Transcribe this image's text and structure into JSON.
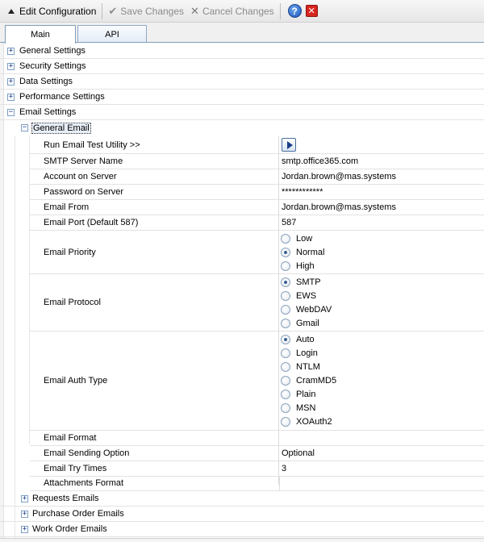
{
  "toolbar": {
    "edit_label": "Edit Configuration",
    "save_label": "Save Changes",
    "cancel_label": "Cancel Changes",
    "help_glyph": "?",
    "close_glyph": "✕",
    "check_glyph": "✔",
    "x_glyph": "✕"
  },
  "tabs": [
    {
      "label": "Main",
      "active": true
    },
    {
      "label": "API",
      "active": false
    }
  ],
  "tree": {
    "expand_glyph": "+",
    "collapse_glyph": "−",
    "sections": [
      {
        "label": "General Settings",
        "expanded": false
      },
      {
        "label": "Security Settings",
        "expanded": false
      },
      {
        "label": "Data Settings",
        "expanded": false
      },
      {
        "label": "Performance Settings",
        "expanded": false
      },
      {
        "label": "Email Settings",
        "expanded": true
      }
    ],
    "general_email": {
      "label": "General Email",
      "expanded": true
    },
    "subsections": [
      {
        "label": "Requests Emails"
      },
      {
        "label": "Purchase Order Emails"
      },
      {
        "label": "Work Order Emails"
      }
    ]
  },
  "props": {
    "run_test": {
      "label": "Run Email Test Utility >>"
    },
    "smtp_server": {
      "label": "SMTP Server Name",
      "value": "smtp.office365.com"
    },
    "account": {
      "label": "Account on Server",
      "value": "Jordan.brown@mas.systems"
    },
    "password": {
      "label": "Password on Server",
      "value": "************"
    },
    "email_from": {
      "label": "Email From",
      "value": "Jordan.brown@mas.systems"
    },
    "email_port": {
      "label": "Email Port (Default 587)",
      "value": "587"
    },
    "priority": {
      "label": "Email Priority",
      "options": [
        "Low",
        "Normal",
        "High"
      ],
      "selected": "Normal"
    },
    "protocol": {
      "label": "Email Protocol",
      "options": [
        "SMTP",
        "EWS",
        "WebDAV",
        "Gmail"
      ],
      "selected": "SMTP"
    },
    "auth": {
      "label": "Email Auth Type",
      "options": [
        "Auto",
        "Login",
        "NTLM",
        "CramMD5",
        "Plain",
        "MSN",
        "XOAuth2"
      ],
      "selected": "Auto"
    },
    "format": {
      "label": "Email Format",
      "value": ""
    },
    "sending_option": {
      "label": "Email Sending Option",
      "value": "Optional"
    },
    "try_times": {
      "label": "Email Try Times",
      "value": "3"
    },
    "attachments": {
      "label": "Attachments Format",
      "value": ""
    }
  },
  "colors": {
    "tab_border": "#7f9db9",
    "expander_border": "#7d9fc4",
    "radio_checked": "#3b5f92",
    "close_red": "#d6261e",
    "help_blue": "#1f55b8"
  }
}
